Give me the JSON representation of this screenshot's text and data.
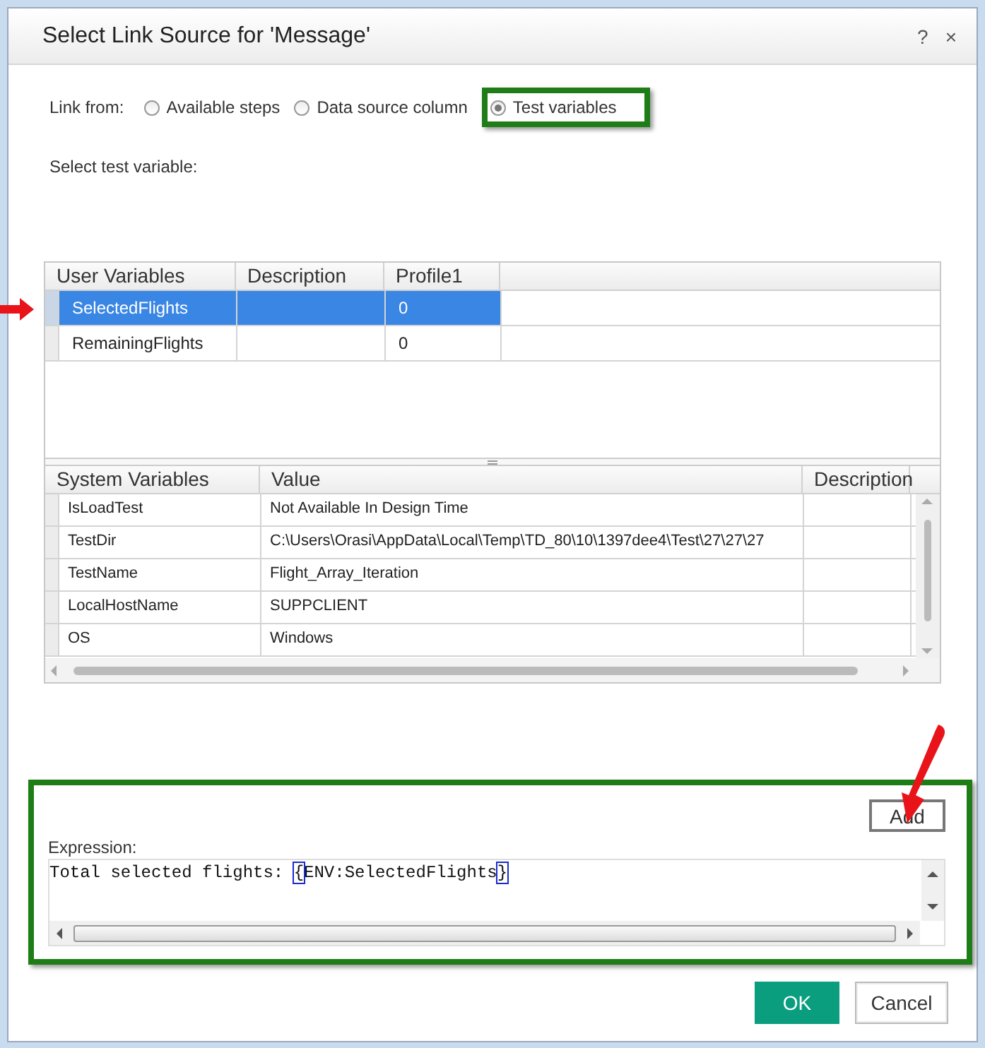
{
  "window": {
    "title": "Select Link Source for 'Message'",
    "help": "?",
    "close": "×"
  },
  "link_from": {
    "label": "Link from:",
    "options": [
      {
        "label": "Available steps",
        "selected": false,
        "highlighted": false
      },
      {
        "label": "Data source column",
        "selected": false,
        "highlighted": false
      },
      {
        "label": "Test variables",
        "selected": true,
        "highlighted": true
      }
    ]
  },
  "prompt": "Select test variable:",
  "user_variables": {
    "columns": [
      "User Variables",
      "Description",
      "Profile1"
    ],
    "rows": [
      {
        "cells": [
          "SelectedFlights",
          "",
          "0"
        ],
        "selected": true,
        "pointed": true
      },
      {
        "cells": [
          "RemainingFlights",
          "",
          "0"
        ],
        "selected": false,
        "pointed": false
      }
    ]
  },
  "system_variables": {
    "columns": [
      "System Variables",
      "Value",
      "Description"
    ],
    "rows": [
      {
        "cells": [
          "IsLoadTest",
          "Not Available In Design Time",
          ""
        ]
      },
      {
        "cells": [
          "TestDir",
          "C:\\Users\\Orasi\\AppData\\Local\\Temp\\TD_80\\10\\1397dee4\\Test\\27\\27\\27",
          ""
        ]
      },
      {
        "cells": [
          "TestName",
          "Flight_Array_Iteration",
          ""
        ]
      },
      {
        "cells": [
          "LocalHostName",
          "SUPPCLIENT",
          ""
        ]
      },
      {
        "cells": [
          "OS",
          "Windows",
          ""
        ]
      }
    ]
  },
  "expression": {
    "highlighted": true,
    "add_button": "Add",
    "label": "Expression:",
    "segments": [
      {
        "text": "Total selected flights: ",
        "matched": false
      },
      {
        "text": "{",
        "matched": true
      },
      {
        "text": "ENV:SelectedFlights",
        "matched": false
      },
      {
        "text": "}",
        "matched": true
      }
    ]
  },
  "buttons": [
    {
      "label": "OK",
      "kind": "primary"
    },
    {
      "label": "Cancel",
      "kind": "secondary"
    }
  ]
}
